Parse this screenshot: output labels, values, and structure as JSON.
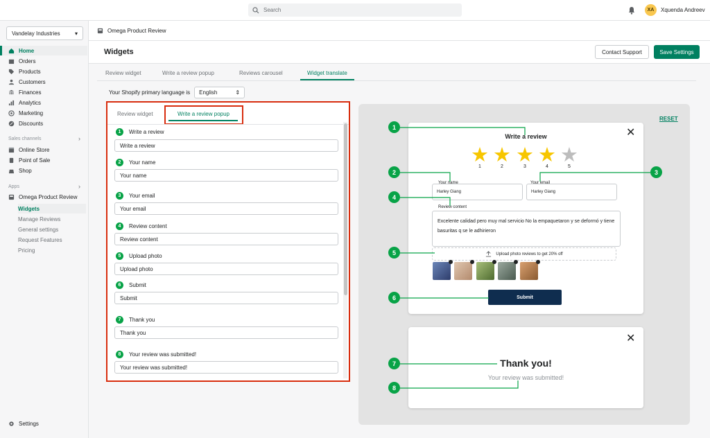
{
  "topbar": {
    "search_placeholder": "Search",
    "avatar_initials": "XA",
    "user_name": "Xquenda Andreev"
  },
  "sidebar": {
    "store_name": "Vandelay Industries",
    "items": [
      {
        "label": "Home",
        "icon": "home-icon",
        "active": true
      },
      {
        "label": "Orders",
        "icon": "orders-icon"
      },
      {
        "label": "Products",
        "icon": "tag-icon"
      },
      {
        "label": "Customers",
        "icon": "person-icon"
      },
      {
        "label": "Finances",
        "icon": "bank-icon"
      },
      {
        "label": "Analytics",
        "icon": "chart-icon"
      },
      {
        "label": "Marketing",
        "icon": "target-icon"
      },
      {
        "label": "Discounts",
        "icon": "discount-icon"
      }
    ],
    "sales_channels_label": "Sales channels",
    "channels": [
      {
        "label": "Online Store",
        "icon": "store-icon"
      },
      {
        "label": "Point of Sale",
        "icon": "pos-icon"
      },
      {
        "label": "Shop",
        "icon": "shop-icon"
      }
    ],
    "apps_label": "Apps",
    "app_name": "Omega Product Review",
    "app_subitems": [
      {
        "label": "Widgets",
        "active": true
      },
      {
        "label": "Manage Reviews"
      },
      {
        "label": "General settings"
      },
      {
        "label": "Request Features"
      },
      {
        "label": "Pricing"
      }
    ],
    "settings_label": "Settings"
  },
  "appbar": {
    "title": "Omega Product Review"
  },
  "page": {
    "title": "Widgets",
    "contact_support": "Contact Support",
    "save_settings": "Save Settings"
  },
  "tabs": [
    {
      "label": "Review widget"
    },
    {
      "label": "Write a review popup"
    },
    {
      "label": "Reviews carousel"
    },
    {
      "label": "Widget translate",
      "active": true
    }
  ],
  "language": {
    "label": "Your Shopify primary language is",
    "value": "English"
  },
  "panel": {
    "tabs": [
      {
        "label": "Review widget"
      },
      {
        "label": "Write a review popup",
        "active": true
      }
    ],
    "fields": [
      {
        "num": "1",
        "label": "Write a review",
        "value": "Write a review"
      },
      {
        "num": "2",
        "label": "Your name",
        "value": "Your name"
      },
      {
        "num": "3",
        "label": "Your email",
        "value": "Your email"
      },
      {
        "num": "4",
        "label": "Review content",
        "value": "Review content"
      },
      {
        "num": "5",
        "label": "Upload photo",
        "value": "Upload photo"
      },
      {
        "num": "6",
        "label": "Submit",
        "value": "Submit"
      },
      {
        "num": "7",
        "label": "Thank you",
        "value": "Thank you"
      },
      {
        "num": "8",
        "label": "Your review was submitted!",
        "value": "Your review was submitted!"
      }
    ]
  },
  "preview": {
    "reset": "RESET",
    "title": "Write a review",
    "stars": [
      "1",
      "2",
      "3",
      "4",
      "5"
    ],
    "rating": 4,
    "star_color": "#f7c600",
    "star_empty_color": "#bdbdbd",
    "name_label": "Your name",
    "name_value": "Harley Giang",
    "email_label": "Your email",
    "email_value": "Harley Giang",
    "content_label": "Review content",
    "content_value": "Excelente calidad pero muy mal servicio No la empaquetaron y se deformó y tiene basuritas q se le adhirieron",
    "upload_text": "Upload photo reviews to get 20% off",
    "submit": "Submit",
    "thank_title": "Thank you!",
    "thank_sub": "Your review was submitted!",
    "callouts": [
      "1",
      "2",
      "3",
      "4",
      "5",
      "6",
      "7",
      "8"
    ]
  }
}
